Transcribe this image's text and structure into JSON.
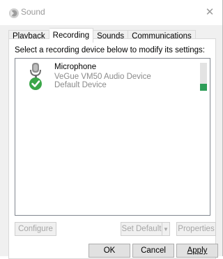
{
  "window": {
    "title": "Sound",
    "close_glyph": "✕"
  },
  "tabs": [
    {
      "label": "Playback",
      "active": false
    },
    {
      "label": "Recording",
      "active": true
    },
    {
      "label": "Sounds",
      "active": false
    },
    {
      "label": "Communications",
      "active": false
    }
  ],
  "recording": {
    "instruction": "Select a recording device below to modify its settings:",
    "devices": [
      {
        "name": "Microphone",
        "device": "VeGue VM50 Audio Device",
        "status": "Default Device",
        "icon": "microphone-icon",
        "level": 0.25
      }
    ]
  },
  "buttons": {
    "configure": "Configure",
    "set_default": "Set Default",
    "dropdown_glyph": "▼",
    "properties": "Properties",
    "ok": "OK",
    "cancel": "Cancel",
    "apply": "Apply"
  },
  "colors": {
    "disabled_text": "#a6a6a6",
    "mic_green": "#3aa648",
    "level_green": "#2e9e58"
  }
}
